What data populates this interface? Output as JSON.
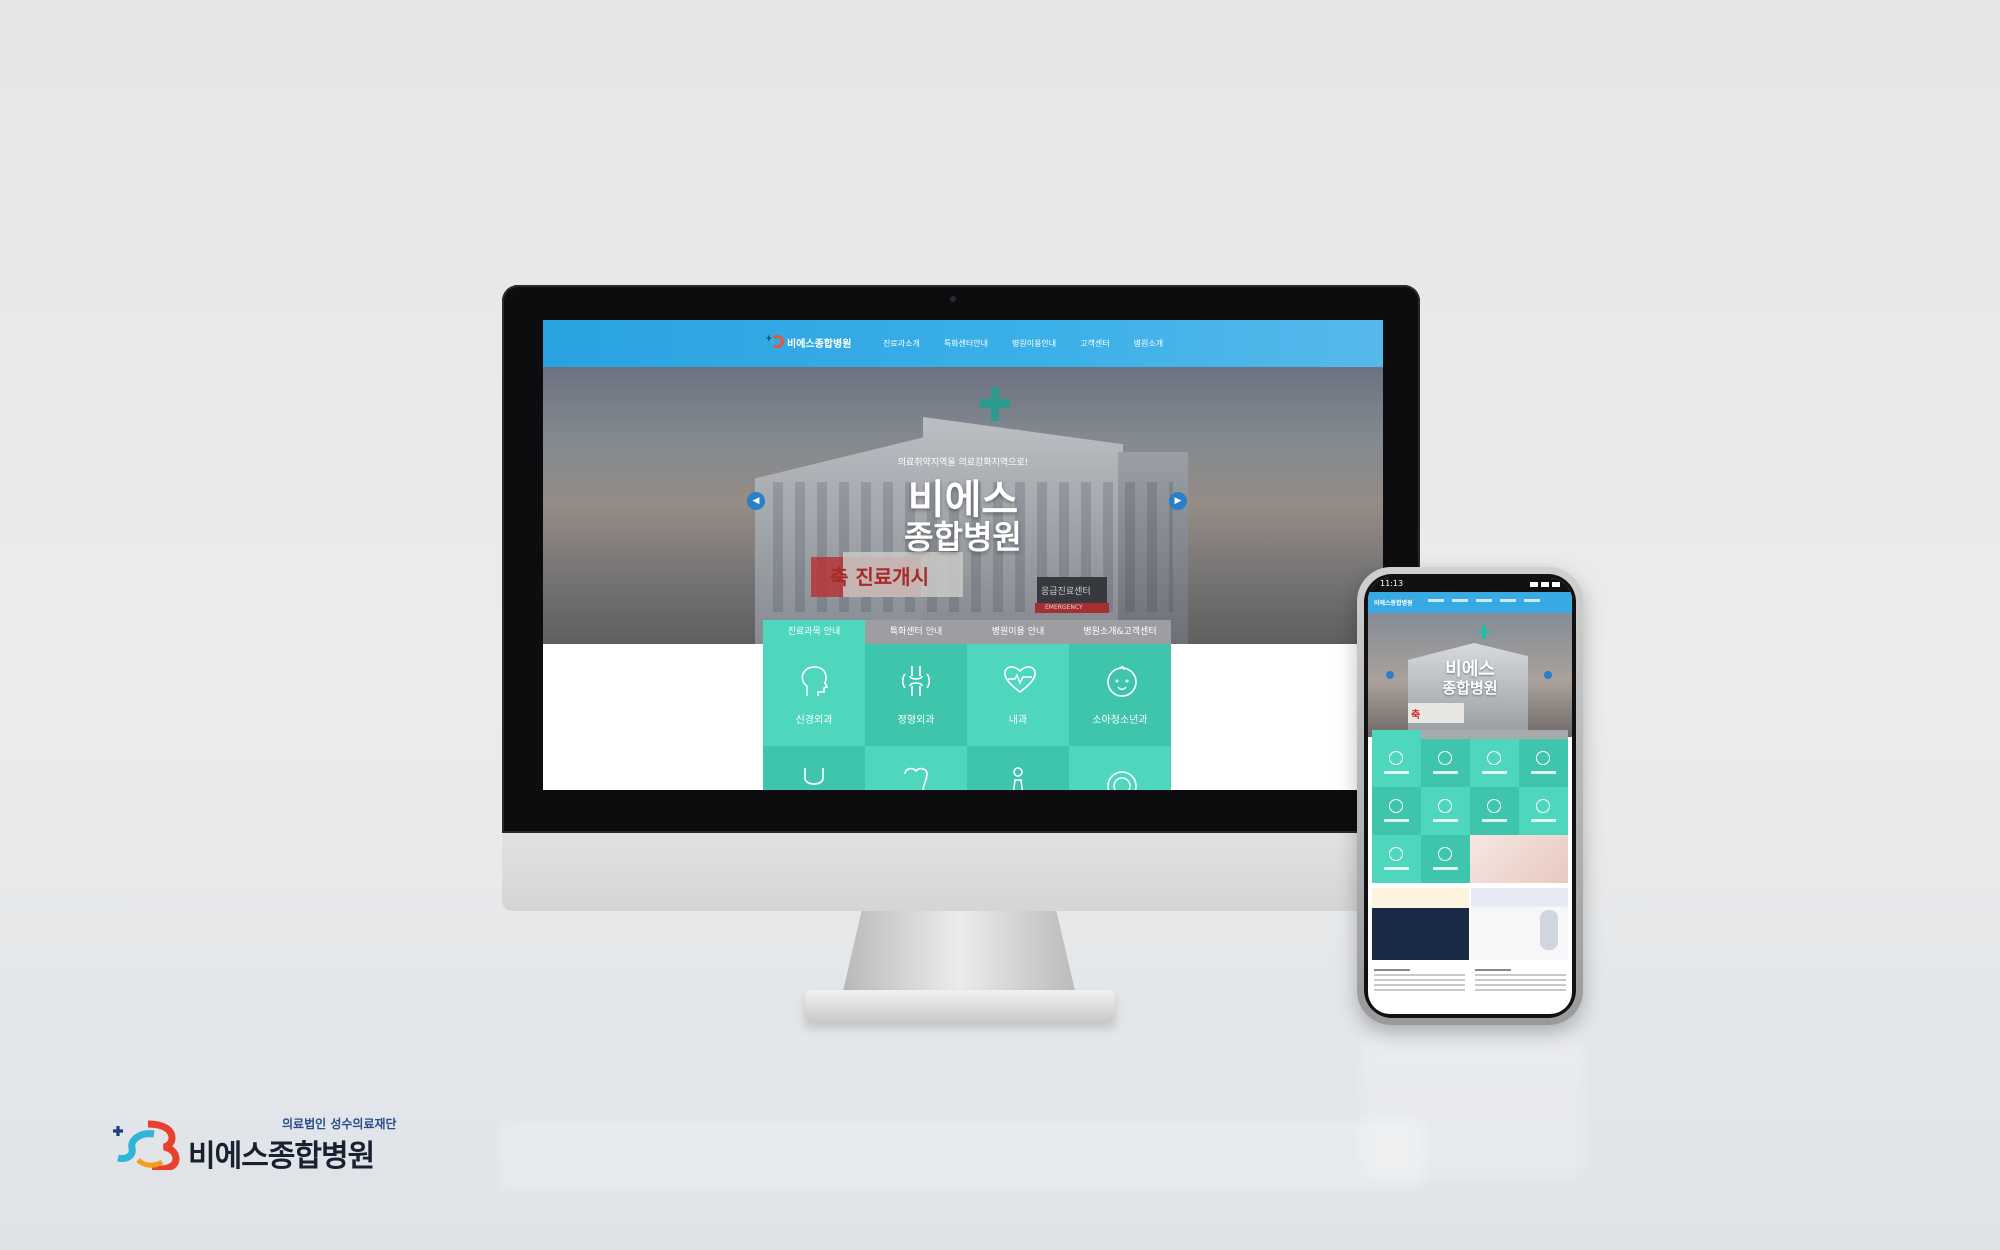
{
  "site": {
    "logo_text": "비에스종합병원",
    "nav": [
      "진료과소개",
      "특화센터안내",
      "병원이용안내",
      "고객센터",
      "병원소개"
    ]
  },
  "hero": {
    "subtitle": "의료취약지역을 의료강화지역으로!",
    "title_line1": "비에스",
    "title_line2": "종합병원",
    "building_sign": "축 진료개시",
    "emergency_sign": "응급진료센터",
    "emergency_label": "EMERGENCY",
    "prev_icon": "chevron-left-icon",
    "next_icon": "chevron-right-icon"
  },
  "tabs": [
    "진료과목 안내",
    "특화센터 안내",
    "병원이용 안내",
    "병원소개&고객센터"
  ],
  "departments": [
    {
      "label": "신경외과",
      "icon": "head-icon"
    },
    {
      "label": "정형외과",
      "icon": "joint-icon"
    },
    {
      "label": "내과",
      "icon": "heart-pulse-icon"
    },
    {
      "label": "소아청소년과",
      "icon": "baby-face-icon"
    },
    {
      "label": "",
      "icon": "stethoscope-icon"
    },
    {
      "label": "",
      "icon": "tooth-icon"
    },
    {
      "label": "",
      "icon": "person-icon"
    },
    {
      "label": "",
      "icon": "ear-icon"
    }
  ],
  "phone": {
    "time": "11:13",
    "title_line1": "비에스",
    "title_line2": "종합병원",
    "sign": "축"
  },
  "brand": {
    "subtitle": "의료법인 성수의료재단",
    "name": "비에스종합병원"
  },
  "colors": {
    "header_blue": "#39a9e3",
    "mint": "#4fd7bd",
    "mint_dark": "#3ec5ab",
    "brand_navy": "#2b4d8f"
  }
}
